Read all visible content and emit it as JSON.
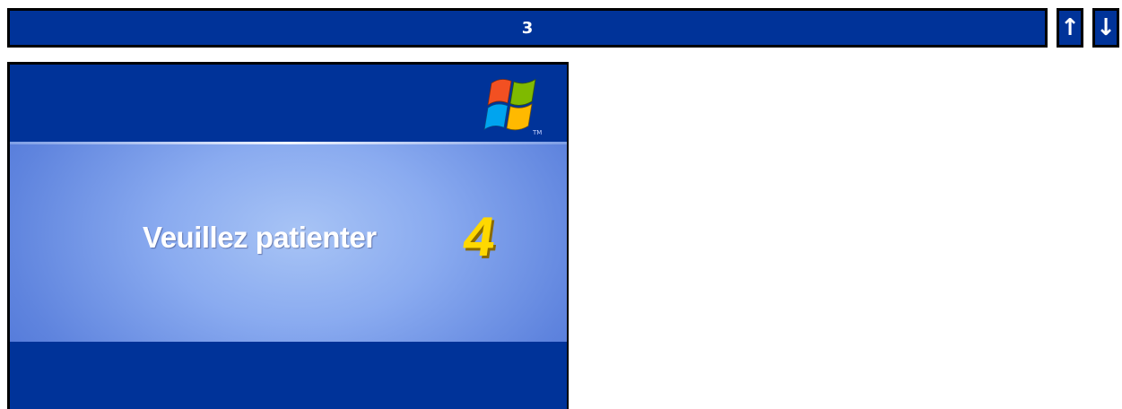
{
  "top_bar": {
    "value": "3",
    "up_icon": "↑",
    "down_icon": "↓"
  },
  "screen": {
    "message": "Veuillez patienter",
    "counter": "4",
    "logo_icon": "windows-flag-logo"
  },
  "colors": {
    "bar_blue": "#003399",
    "screen_blue": "#003399",
    "counter_yellow": "#ffd800"
  }
}
